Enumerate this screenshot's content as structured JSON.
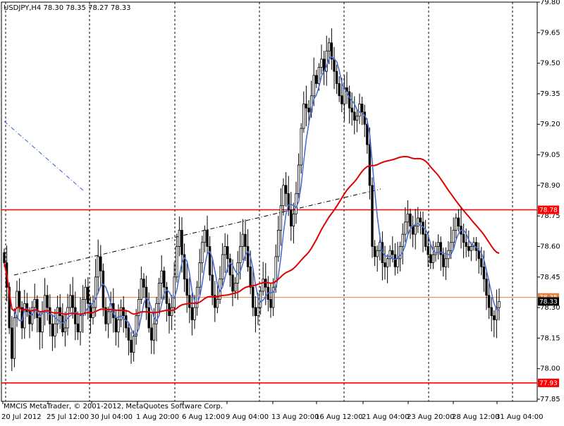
{
  "header": {
    "symbol_info": "USDJPY,H4  78.30 78.35 78.27 78.33"
  },
  "footer": {
    "copyright": "MMCIS MetaTrader, © 2001-2012, MetaQuotes Software Corp."
  },
  "chart_data": {
    "type": "candlestick",
    "symbol": "USDJPY",
    "timeframe": "H4",
    "ohlc_header": {
      "open": 78.3,
      "high": 78.35,
      "low": 78.27,
      "close": 78.33
    },
    "ylim": [
      77.85,
      79.8
    ],
    "y_ticks": [
      "79.80",
      "79.65",
      "79.50",
      "79.35",
      "79.20",
      "79.05",
      "78.90",
      "78.75",
      "78.60",
      "78.45",
      "78.30",
      "78.15",
      "78.00",
      "77.85"
    ],
    "x_ticks": [
      {
        "label": "20 Jul 2012",
        "bar": 0
      },
      {
        "label": "25 Jul 12:00",
        "bar": 22
      },
      {
        "label": "30 Jul 04:00",
        "bar": 40
      },
      {
        "label": "1 Aug 20:00",
        "bar": 58
      },
      {
        "label": "6 Aug 12:00",
        "bar": 76
      },
      {
        "label": "9 Aug 04:00",
        "bar": 94
      },
      {
        "label": "13 Aug 20:00",
        "bar": 112
      },
      {
        "label": "16 Aug 12:00",
        "bar": 130
      },
      {
        "label": "21 Aug 04:00",
        "bar": 148
      },
      {
        "label": "23 Aug 20:00",
        "bar": 166
      },
      {
        "label": "28 Aug 12:00",
        "bar": 184
      },
      {
        "label": "31 Aug 04:00",
        "bar": 202
      }
    ],
    "close_series": [
      78.52,
      78.4,
      78.2,
      78.05,
      78.25,
      78.38,
      78.3,
      78.2,
      78.32,
      78.28,
      78.22,
      78.3,
      78.34,
      78.25,
      78.18,
      78.28,
      78.36,
      78.3,
      78.22,
      78.16,
      78.22,
      78.3,
      78.26,
      78.18,
      78.2,
      78.3,
      78.36,
      78.3,
      78.22,
      78.18,
      78.26,
      78.34,
      78.4,
      78.32,
      78.25,
      78.3,
      78.45,
      78.55,
      78.48,
      78.3,
      78.22,
      78.28,
      78.32,
      78.25,
      78.18,
      78.24,
      78.3,
      78.26,
      78.2,
      78.14,
      78.08,
      78.16,
      78.26,
      78.34,
      78.44,
      78.4,
      78.3,
      78.2,
      78.14,
      78.22,
      78.32,
      78.42,
      78.48,
      78.4,
      78.32,
      78.26,
      78.3,
      78.45,
      78.6,
      78.68,
      78.56,
      78.44,
      78.36,
      78.3,
      78.24,
      78.3,
      78.4,
      78.52,
      78.62,
      78.68,
      78.6,
      78.46,
      78.36,
      78.3,
      78.34,
      78.44,
      78.56,
      78.6,
      78.54,
      78.46,
      78.38,
      78.42,
      78.52,
      78.6,
      78.66,
      78.6,
      78.5,
      78.4,
      78.3,
      78.26,
      78.3,
      78.38,
      78.44,
      78.4,
      78.34,
      78.3,
      78.4,
      78.55,
      78.68,
      78.8,
      78.9,
      78.86,
      78.78,
      78.7,
      78.76,
      78.86,
      79.0,
      79.18,
      79.3,
      79.28,
      79.26,
      79.34,
      79.44,
      79.4,
      79.48,
      79.52,
      79.46,
      79.56,
      79.6,
      79.52,
      79.46,
      79.4,
      79.34,
      79.3,
      79.38,
      79.36,
      79.28,
      79.26,
      79.22,
      79.24,
      79.3,
      79.26,
      79.2,
      79.1,
      78.9,
      78.6,
      78.55,
      78.58,
      78.62,
      78.52,
      78.5,
      78.54,
      78.58,
      78.56,
      78.5,
      78.54,
      78.6,
      78.66,
      78.72,
      78.76,
      78.7,
      78.66,
      78.7,
      78.74,
      78.72,
      78.66,
      78.6,
      78.56,
      78.52,
      78.56,
      78.6,
      78.62,
      78.56,
      78.5,
      78.54,
      78.58,
      78.62,
      78.68,
      78.74,
      78.7,
      78.66,
      78.62,
      78.6,
      78.58,
      78.6,
      78.62,
      78.58,
      78.54,
      78.5,
      78.44,
      78.36,
      78.3,
      78.26,
      78.24,
      78.3,
      78.33
    ],
    "series": [
      {
        "name": "fast-ma",
        "color": "#4a6fd6",
        "period": 5
      },
      {
        "name": "slow-ma",
        "color": "#e00000",
        "period": 50
      }
    ],
    "horizontal_lines": [
      {
        "price": 78.78,
        "label": "78.78",
        "color": "#ff0000"
      },
      {
        "price": 77.93,
        "label": "77.93",
        "color": "#ff0000"
      },
      {
        "price": 78.35,
        "label": "78.35",
        "color": "#e08040"
      }
    ],
    "current_price": {
      "value": 78.33,
      "label": "78.33"
    },
    "colors": {
      "bull": "#ffffff",
      "bear": "#000000",
      "wick": "#000000",
      "grid": "#000000"
    }
  }
}
